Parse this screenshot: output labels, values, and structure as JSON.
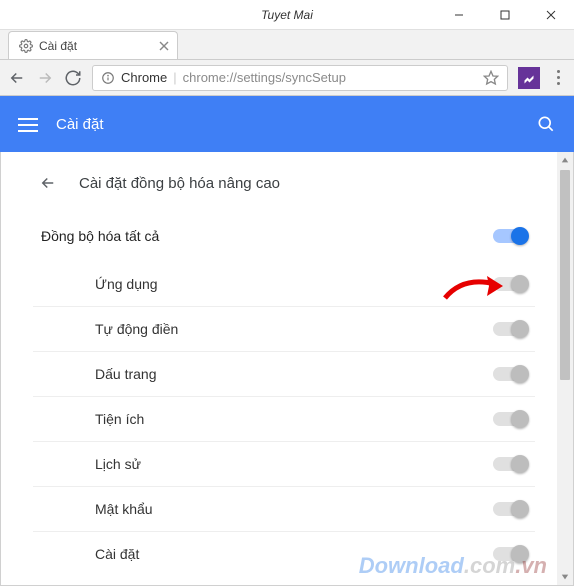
{
  "window": {
    "title": "Tuyet Mai"
  },
  "tab": {
    "title": "Cài đặt"
  },
  "address": {
    "prefix": "Chrome",
    "url": "chrome://settings/syncSetup"
  },
  "header": {
    "title": "Cài đặt"
  },
  "section": {
    "title": "Cài đặt đồng bộ hóa nâng cao"
  },
  "master": {
    "label": "Đồng bộ hóa tất cả",
    "on": true
  },
  "items": [
    {
      "label": "Ứng dụng"
    },
    {
      "label": "Tự động điền"
    },
    {
      "label": "Dấu trang"
    },
    {
      "label": "Tiện ích"
    },
    {
      "label": "Lịch sử"
    },
    {
      "label": "Mật khẩu"
    },
    {
      "label": "Cài đặt"
    }
  ],
  "watermark": {
    "text1": "Download",
    "text2": ".com",
    "text3": ".vn"
  }
}
